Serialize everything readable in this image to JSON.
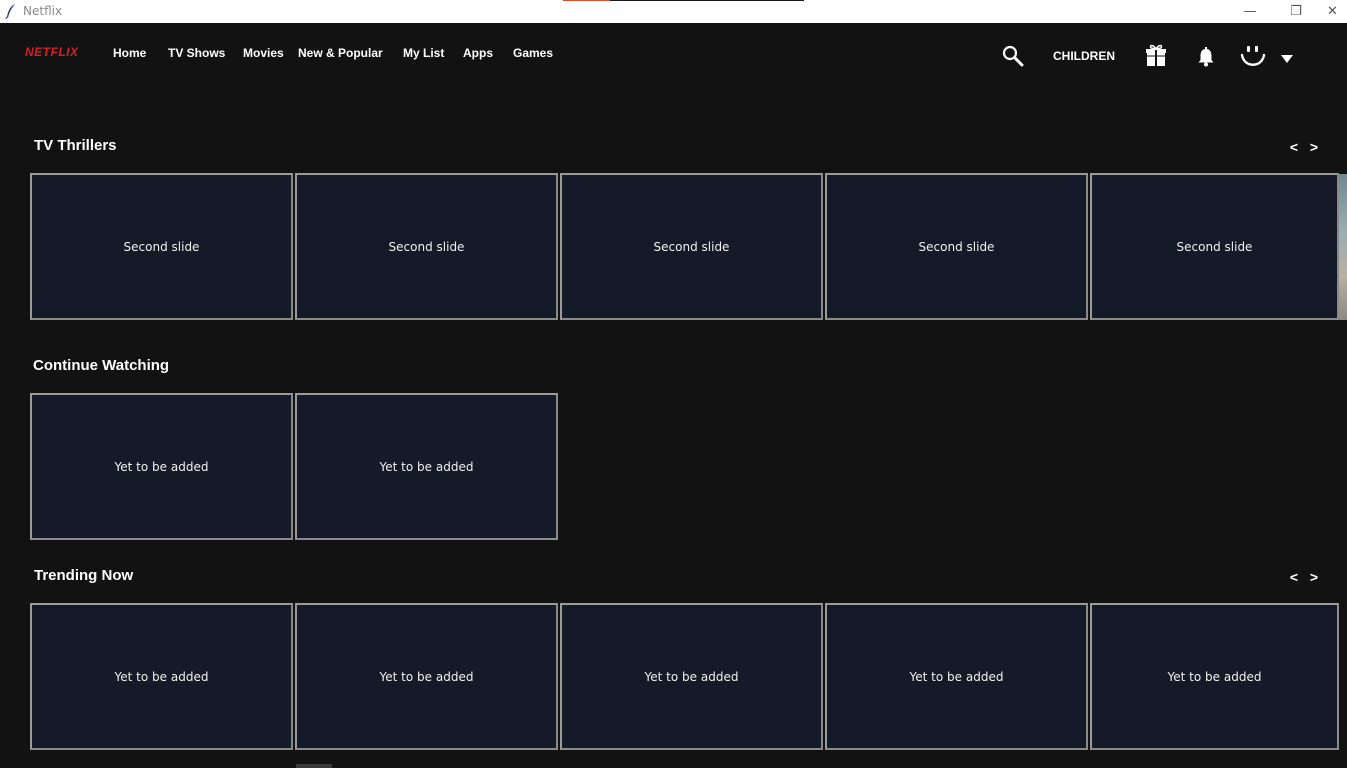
{
  "window": {
    "title": "Netflix",
    "controls": {
      "minimize": "—",
      "maximize": "❐",
      "close": "✕"
    }
  },
  "nav": {
    "logo": "NETFLIX",
    "links": [
      "Home",
      "TV Shows",
      "Movies",
      "New & Popular",
      "My List",
      "Apps",
      "Games"
    ],
    "children_label": "CHILDREN",
    "icons": [
      "search-icon",
      "gift-icon",
      "bell-icon",
      "profile-smiley-icon",
      "caret-down-icon"
    ]
  },
  "rows": [
    {
      "title": "TV Thrillers",
      "has_arrows": true,
      "cards": [
        "Second slide",
        "Second slide",
        "Second slide",
        "Second slide",
        "Second slide"
      ]
    },
    {
      "title": "Continue Watching",
      "has_arrows": false,
      "cards": [
        "Yet to be added",
        "Yet to be added"
      ]
    },
    {
      "title": "Trending Now",
      "has_arrows": true,
      "cards": [
        "Yet to be added",
        "Yet to be added",
        "Yet to be added",
        "Yet to be added",
        "Yet to be added"
      ]
    }
  ],
  "arrows": {
    "prev": "<",
    "next": ">"
  },
  "colors": {
    "background": "#121212",
    "brand_red": "#d81f26",
    "card_bg": "#141a27",
    "card_border": "#8a8a8a"
  }
}
